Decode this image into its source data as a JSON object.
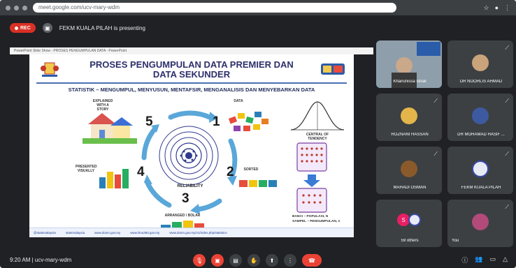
{
  "browser": {
    "url": "meet.google.com/ucv-mary-wdm"
  },
  "meet": {
    "rec_label": "REC",
    "presenting_text": "FEKM KUALA PILAH is presenting"
  },
  "ppt": {
    "titlebar": "PowerPoint Slide Show  -  PROSES PENGUMPULAN DATA  -  PowerPoint"
  },
  "slide": {
    "title_line1": "PROSES PENGUMPULAN DATA PREMIER DAN",
    "title_line2": "DATA SEKUNDER",
    "subtitle": "STATISTIK – MENGUMPUL, MENYUSUN, MENTAFSIR, MENGANALISIS DAN MENYEBARKAN DATA",
    "steps": [
      {
        "num": "1",
        "label": "DATA"
      },
      {
        "num": "2",
        "label": "SORTED"
      },
      {
        "num": "3",
        "label": "ARRANGED / BOLAR"
      },
      {
        "num": "4",
        "label": "PRESENTED VISUALLY"
      },
      {
        "num": "5",
        "label": "EXPLAINED WITH A STORY"
      }
    ],
    "reliability": "RELIABILITY",
    "curve_label": "CENTRAL OF TENDENCY",
    "population_text_1": "BANCI – POPULASI, N",
    "population_text_2": "SAMPEL – PENGUMPULAN, n",
    "footer": [
      "@statsmalaysia",
      "statsmalaysia",
      "www.dosm.gov.my",
      "www.ilmu360.gov.my",
      "www.dosm.gov.my/v1/index.php/statistics"
    ]
  },
  "participants": [
    {
      "name": "Khairunissa Ishak",
      "avatar_color": "#6b7f8f"
    },
    {
      "name": "DR NOORLIS AHMAD",
      "avatar_color": "#c9a37a"
    },
    {
      "name": "ROZNANI HASSAN",
      "avatar_color": "#e3b54a"
    },
    {
      "name": "DR MOHAMAD HASIF ...",
      "avatar_color": "#3d5aa0"
    },
    {
      "name": "MAHADI OSMAN",
      "avatar_color": "#8b5a2b"
    },
    {
      "name": "FEKM KUALA PILAH",
      "avatar_color": "#e8eaf6"
    },
    {
      "name": "59 others",
      "avatar_color": "#e91e63"
    },
    {
      "name": "You",
      "avatar_color": "#b24a7a"
    }
  ],
  "footer_bar": {
    "clock": "9:20 AM  |  ucv-mary-wdm"
  },
  "colors": {
    "rec": "#d93025",
    "hangup": "#ea4335",
    "tile_bg": "#3c4043",
    "slide_title": "#2d2f6b"
  }
}
